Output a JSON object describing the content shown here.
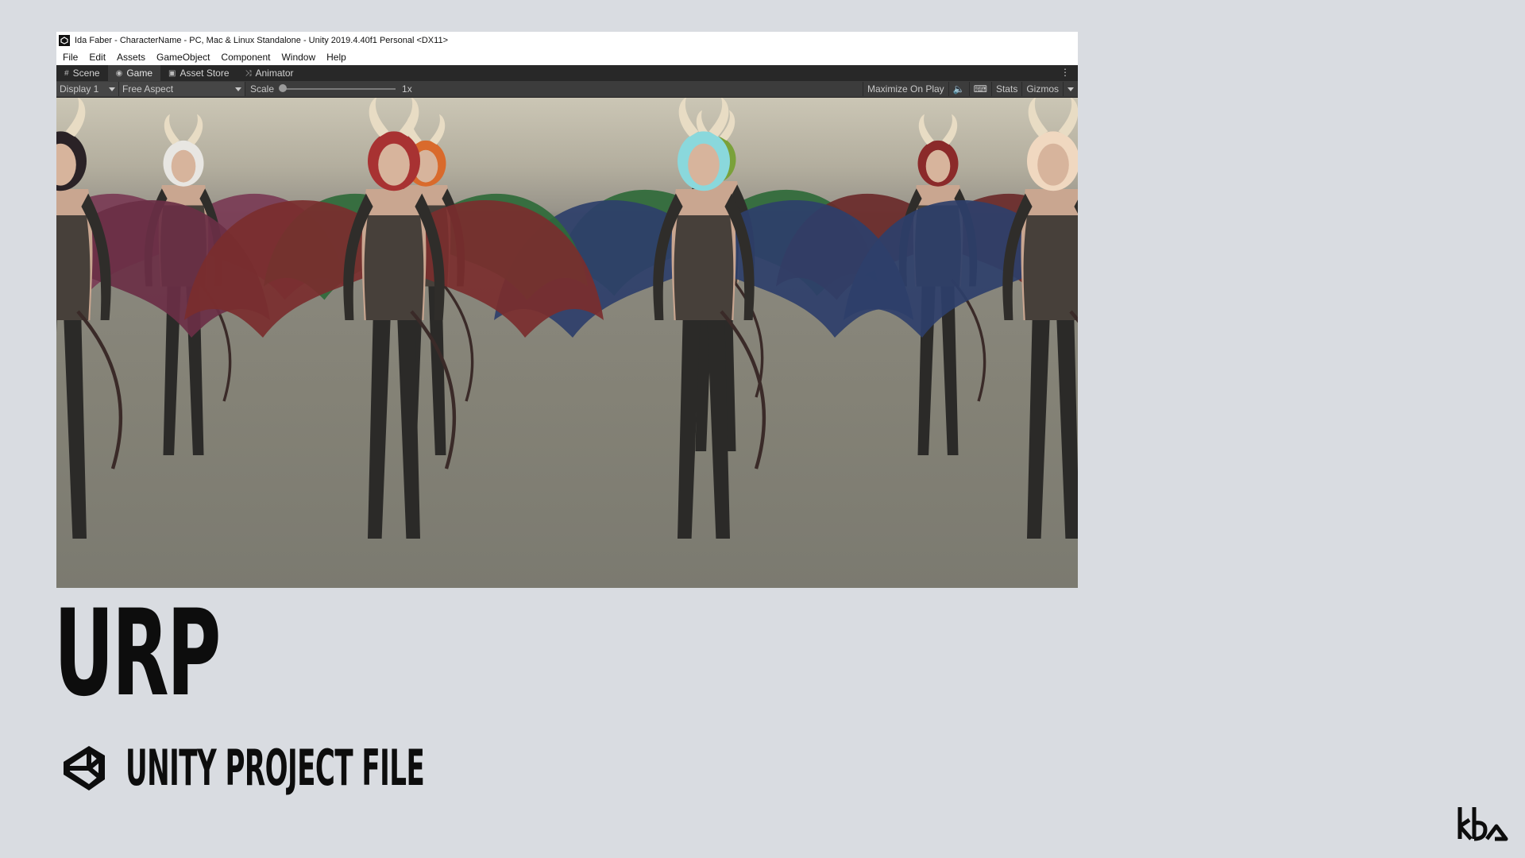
{
  "window": {
    "title": "Ida Faber - CharacterName - PC, Mac & Linux Standalone - Unity 2019.4.40f1 Personal <DX11>"
  },
  "menu": [
    "File",
    "Edit",
    "Assets",
    "GameObject",
    "Component",
    "Window",
    "Help"
  ],
  "tabs": [
    {
      "label": "Scene",
      "icon": "grid-icon"
    },
    {
      "label": "Game",
      "icon": "gamepad-icon",
      "active": true
    },
    {
      "label": "Asset Store",
      "icon": "bag-icon"
    },
    {
      "label": "Animator",
      "icon": "animator-icon"
    }
  ],
  "toolbar": {
    "display": "Display 1",
    "aspect": "Free Aspect",
    "scale_label": "Scale",
    "scale_value": "1x",
    "maximize": "Maximize On Play",
    "stats": "Stats",
    "gizmos": "Gizmos"
  },
  "viewport": {
    "characters": [
      {
        "hair": "#2a2226",
        "wings": "#6a2f45"
      },
      {
        "hair": "#e8e6e2",
        "wings": "#7a3b55"
      },
      {
        "hair": "#d96a2c",
        "wings": "#2f6a3a"
      },
      {
        "hair": "#7aa13a",
        "wings": "#2f6a3a"
      },
      {
        "hair": "#8b2a2a",
        "wings": "#6a2a2a"
      },
      {
        "hair": "#a83232",
        "wings": "#7a2e2e"
      },
      {
        "hair": "#8ad8dc",
        "wings": "#2e3f6a"
      },
      {
        "hair": "#f0d8c0",
        "wings": "#2e3f6a"
      }
    ]
  },
  "hero": {
    "big": "URP",
    "sub": "UNITY PROJECT FILE"
  }
}
